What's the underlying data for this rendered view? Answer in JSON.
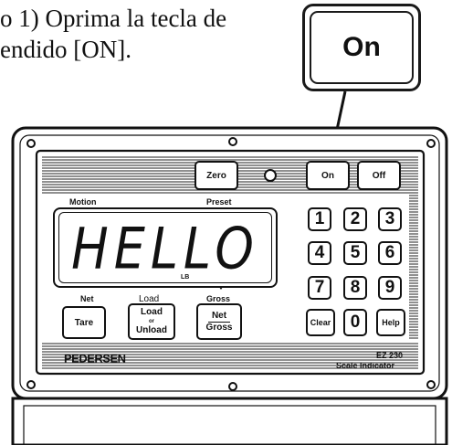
{
  "caption": {
    "line1": "o 1) Oprima la tecla de",
    "line2": "endido [ON]."
  },
  "callout": {
    "label": "On"
  },
  "indicator": {
    "labels": {
      "motion": "Motion",
      "preset": "Preset",
      "net": "Net",
      "load": "Load",
      "gross": "Gross",
      "lb": "LB"
    },
    "display_text": "HELLO",
    "buttons": {
      "zero": "Zero",
      "on": "On",
      "off": "Off",
      "tare": "Tare",
      "load_top": "Load",
      "load_or": "or",
      "load_bottom": "Unload",
      "net": "Net",
      "gross": "Gross",
      "clear": "Clear",
      "help": "Help"
    },
    "keypad": [
      "1",
      "2",
      "3",
      "4",
      "5",
      "6",
      "7",
      "8",
      "9",
      "0"
    ],
    "brand": "PEDERSEN",
    "model_line1": "EZ 230",
    "model_line2": "Scale Indicator"
  }
}
